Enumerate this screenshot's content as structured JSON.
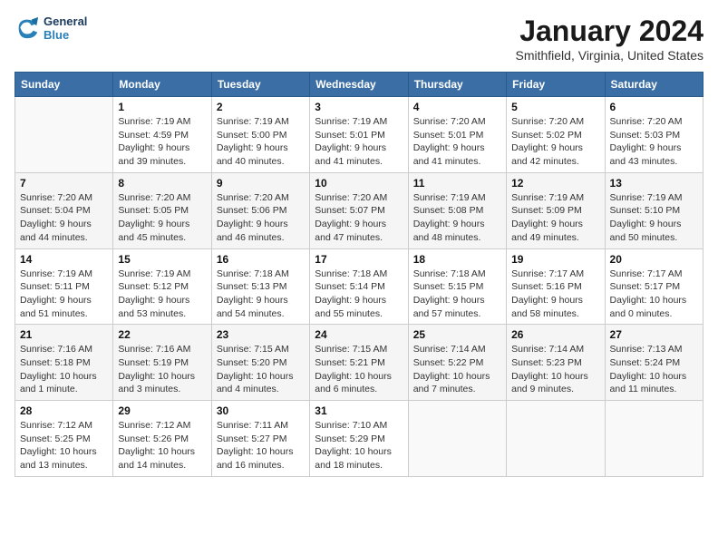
{
  "header": {
    "logo_line1": "General",
    "logo_line2": "Blue",
    "month_title": "January 2024",
    "location": "Smithfield, Virginia, United States"
  },
  "weekdays": [
    "Sunday",
    "Monday",
    "Tuesday",
    "Wednesday",
    "Thursday",
    "Friday",
    "Saturday"
  ],
  "weeks": [
    [
      {
        "day": "",
        "sunrise": "",
        "sunset": "",
        "daylight": ""
      },
      {
        "day": "1",
        "sunrise": "Sunrise: 7:19 AM",
        "sunset": "Sunset: 4:59 PM",
        "daylight": "Daylight: 9 hours and 39 minutes."
      },
      {
        "day": "2",
        "sunrise": "Sunrise: 7:19 AM",
        "sunset": "Sunset: 5:00 PM",
        "daylight": "Daylight: 9 hours and 40 minutes."
      },
      {
        "day": "3",
        "sunrise": "Sunrise: 7:19 AM",
        "sunset": "Sunset: 5:01 PM",
        "daylight": "Daylight: 9 hours and 41 minutes."
      },
      {
        "day": "4",
        "sunrise": "Sunrise: 7:20 AM",
        "sunset": "Sunset: 5:01 PM",
        "daylight": "Daylight: 9 hours and 41 minutes."
      },
      {
        "day": "5",
        "sunrise": "Sunrise: 7:20 AM",
        "sunset": "Sunset: 5:02 PM",
        "daylight": "Daylight: 9 hours and 42 minutes."
      },
      {
        "day": "6",
        "sunrise": "Sunrise: 7:20 AM",
        "sunset": "Sunset: 5:03 PM",
        "daylight": "Daylight: 9 hours and 43 minutes."
      }
    ],
    [
      {
        "day": "7",
        "sunrise": "Sunrise: 7:20 AM",
        "sunset": "Sunset: 5:04 PM",
        "daylight": "Daylight: 9 hours and 44 minutes."
      },
      {
        "day": "8",
        "sunrise": "Sunrise: 7:20 AM",
        "sunset": "Sunset: 5:05 PM",
        "daylight": "Daylight: 9 hours and 45 minutes."
      },
      {
        "day": "9",
        "sunrise": "Sunrise: 7:20 AM",
        "sunset": "Sunset: 5:06 PM",
        "daylight": "Daylight: 9 hours and 46 minutes."
      },
      {
        "day": "10",
        "sunrise": "Sunrise: 7:20 AM",
        "sunset": "Sunset: 5:07 PM",
        "daylight": "Daylight: 9 hours and 47 minutes."
      },
      {
        "day": "11",
        "sunrise": "Sunrise: 7:19 AM",
        "sunset": "Sunset: 5:08 PM",
        "daylight": "Daylight: 9 hours and 48 minutes."
      },
      {
        "day": "12",
        "sunrise": "Sunrise: 7:19 AM",
        "sunset": "Sunset: 5:09 PM",
        "daylight": "Daylight: 9 hours and 49 minutes."
      },
      {
        "day": "13",
        "sunrise": "Sunrise: 7:19 AM",
        "sunset": "Sunset: 5:10 PM",
        "daylight": "Daylight: 9 hours and 50 minutes."
      }
    ],
    [
      {
        "day": "14",
        "sunrise": "Sunrise: 7:19 AM",
        "sunset": "Sunset: 5:11 PM",
        "daylight": "Daylight: 9 hours and 51 minutes."
      },
      {
        "day": "15",
        "sunrise": "Sunrise: 7:19 AM",
        "sunset": "Sunset: 5:12 PM",
        "daylight": "Daylight: 9 hours and 53 minutes."
      },
      {
        "day": "16",
        "sunrise": "Sunrise: 7:18 AM",
        "sunset": "Sunset: 5:13 PM",
        "daylight": "Daylight: 9 hours and 54 minutes."
      },
      {
        "day": "17",
        "sunrise": "Sunrise: 7:18 AM",
        "sunset": "Sunset: 5:14 PM",
        "daylight": "Daylight: 9 hours and 55 minutes."
      },
      {
        "day": "18",
        "sunrise": "Sunrise: 7:18 AM",
        "sunset": "Sunset: 5:15 PM",
        "daylight": "Daylight: 9 hours and 57 minutes."
      },
      {
        "day": "19",
        "sunrise": "Sunrise: 7:17 AM",
        "sunset": "Sunset: 5:16 PM",
        "daylight": "Daylight: 9 hours and 58 minutes."
      },
      {
        "day": "20",
        "sunrise": "Sunrise: 7:17 AM",
        "sunset": "Sunset: 5:17 PM",
        "daylight": "Daylight: 10 hours and 0 minutes."
      }
    ],
    [
      {
        "day": "21",
        "sunrise": "Sunrise: 7:16 AM",
        "sunset": "Sunset: 5:18 PM",
        "daylight": "Daylight: 10 hours and 1 minute."
      },
      {
        "day": "22",
        "sunrise": "Sunrise: 7:16 AM",
        "sunset": "Sunset: 5:19 PM",
        "daylight": "Daylight: 10 hours and 3 minutes."
      },
      {
        "day": "23",
        "sunrise": "Sunrise: 7:15 AM",
        "sunset": "Sunset: 5:20 PM",
        "daylight": "Daylight: 10 hours and 4 minutes."
      },
      {
        "day": "24",
        "sunrise": "Sunrise: 7:15 AM",
        "sunset": "Sunset: 5:21 PM",
        "daylight": "Daylight: 10 hours and 6 minutes."
      },
      {
        "day": "25",
        "sunrise": "Sunrise: 7:14 AM",
        "sunset": "Sunset: 5:22 PM",
        "daylight": "Daylight: 10 hours and 7 minutes."
      },
      {
        "day": "26",
        "sunrise": "Sunrise: 7:14 AM",
        "sunset": "Sunset: 5:23 PM",
        "daylight": "Daylight: 10 hours and 9 minutes."
      },
      {
        "day": "27",
        "sunrise": "Sunrise: 7:13 AM",
        "sunset": "Sunset: 5:24 PM",
        "daylight": "Daylight: 10 hours and 11 minutes."
      }
    ],
    [
      {
        "day": "28",
        "sunrise": "Sunrise: 7:12 AM",
        "sunset": "Sunset: 5:25 PM",
        "daylight": "Daylight: 10 hours and 13 minutes."
      },
      {
        "day": "29",
        "sunrise": "Sunrise: 7:12 AM",
        "sunset": "Sunset: 5:26 PM",
        "daylight": "Daylight: 10 hours and 14 minutes."
      },
      {
        "day": "30",
        "sunrise": "Sunrise: 7:11 AM",
        "sunset": "Sunset: 5:27 PM",
        "daylight": "Daylight: 10 hours and 16 minutes."
      },
      {
        "day": "31",
        "sunrise": "Sunrise: 7:10 AM",
        "sunset": "Sunset: 5:29 PM",
        "daylight": "Daylight: 10 hours and 18 minutes."
      },
      {
        "day": "",
        "sunrise": "",
        "sunset": "",
        "daylight": ""
      },
      {
        "day": "",
        "sunrise": "",
        "sunset": "",
        "daylight": ""
      },
      {
        "day": "",
        "sunrise": "",
        "sunset": "",
        "daylight": ""
      }
    ]
  ]
}
